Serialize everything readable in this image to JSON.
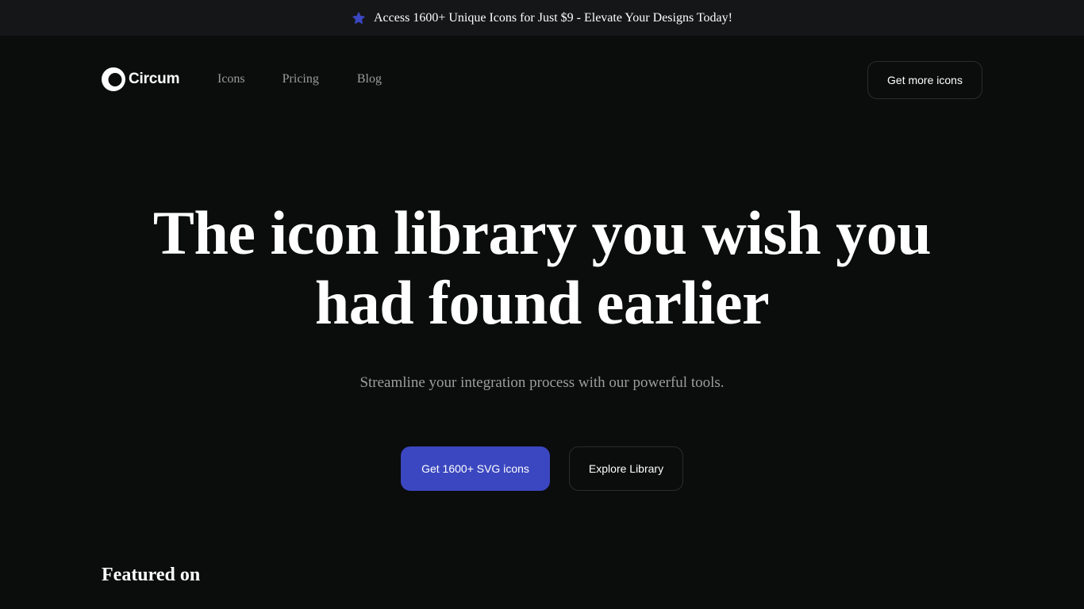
{
  "banner": {
    "icon": "star-icon",
    "text": "Access 1600+ Unique Icons for Just $9 - Elevate Your Designs Today!",
    "icon_color": "#3b47c0"
  },
  "header": {
    "logo_text": "Circum",
    "nav": [
      {
        "label": "Icons"
      },
      {
        "label": "Pricing"
      },
      {
        "label": "Blog"
      }
    ],
    "cta_label": "Get more icons"
  },
  "hero": {
    "title": "The icon library you wish you had found earlier",
    "subtitle": "Streamline your integration process with our powerful tools.",
    "primary_cta": "Get 1600+ SVG icons",
    "secondary_cta": "Explore Library"
  },
  "featured": {
    "heading": "Featured on"
  },
  "colors": {
    "background": "#0b0c0c",
    "banner_bg": "#151617",
    "accent": "#3b47c0",
    "muted_text": "#9a9b9c"
  }
}
